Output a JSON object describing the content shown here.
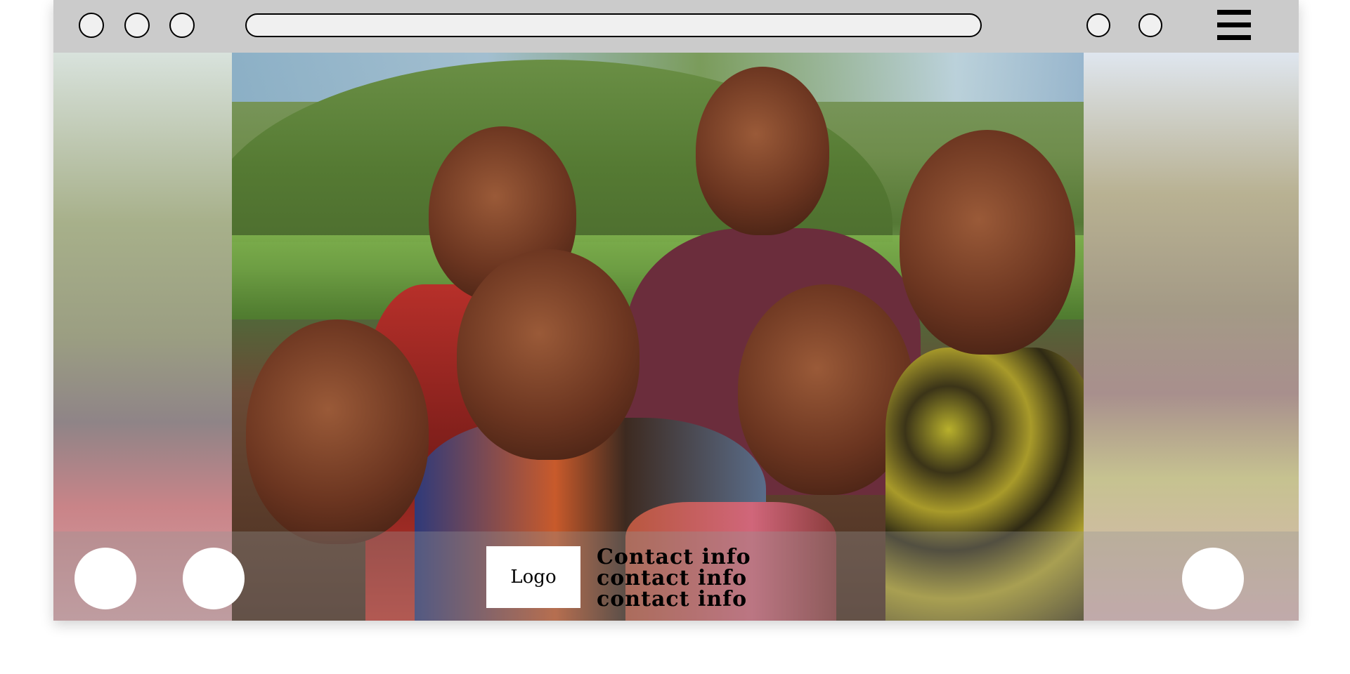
{
  "window": {
    "controls": [
      {
        "name": "window-control-1",
        "icon": "circle-icon"
      },
      {
        "name": "window-control-2",
        "icon": "circle-icon"
      },
      {
        "name": "window-control-3",
        "icon": "circle-icon"
      }
    ],
    "address_bar": {
      "value": "",
      "placeholder": ""
    },
    "toolbar_buttons": [
      {
        "name": "toolbar-button-1",
        "icon": "circle-icon"
      },
      {
        "name": "toolbar-button-2",
        "icon": "circle-icon"
      }
    ],
    "menu_icon": "hamburger-menu-icon"
  },
  "hero": {
    "image_subject": "group of smiling children outdoors"
  },
  "footer": {
    "logo_label": "Logo",
    "contact_lines": [
      "Contact info",
      "contact info",
      "contact info"
    ],
    "social_buttons": [
      "social-button-left-1",
      "social-button-left-2",
      "social-button-right"
    ]
  },
  "colors": {
    "topbar": "#cbcbcb",
    "button_fill": "#f0f0f0",
    "footer_overlay": "rgba(150,150,150,0.35)",
    "logo_bg": "#ffffff"
  }
}
